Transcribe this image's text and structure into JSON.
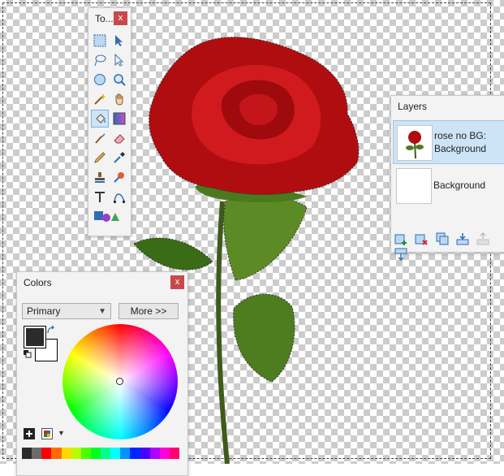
{
  "tools_panel": {
    "title": "To...",
    "close": "x",
    "tools": [
      {
        "icon": "rectangle-select-icon"
      },
      {
        "icon": "move-selection-icon"
      },
      {
        "icon": "lasso-select-icon"
      },
      {
        "icon": "move-selected-icon"
      },
      {
        "icon": "ellipse-select-icon"
      },
      {
        "icon": "zoom-icon"
      },
      {
        "icon": "magic-wand-icon"
      },
      {
        "icon": "pan-icon"
      },
      {
        "icon": "paint-bucket-icon"
      },
      {
        "icon": "gradient-icon"
      },
      {
        "icon": "paintbrush-icon"
      },
      {
        "icon": "eraser-icon"
      },
      {
        "icon": "pencil-icon"
      },
      {
        "icon": "color-picker-icon"
      },
      {
        "icon": "clone-stamp-icon"
      },
      {
        "icon": "recolor-icon"
      },
      {
        "icon": "text-icon"
      },
      {
        "icon": "line-curve-icon"
      },
      {
        "icon": "shapes-icon"
      }
    ],
    "active_tool": "paint-bucket-icon"
  },
  "layers_panel": {
    "title": "Layers",
    "layers": [
      {
        "name_line1": "rose no BG:",
        "name_line2": "Background"
      },
      {
        "name_line1": "Background",
        "name_line2": ""
      }
    ],
    "toolbar": [
      "add-layer-icon",
      "delete-layer-icon",
      "duplicate-layer-icon",
      "merge-layer-down-icon",
      "move-layer-up-icon",
      "move-layer-down-icon"
    ]
  },
  "colors_panel": {
    "title": "Colors",
    "close": "x",
    "mode": "Primary",
    "more_label": "More >>",
    "primary_color": "#2b2b2b",
    "secondary_color": "#ffffff",
    "palette": [
      "#2b2b2b",
      "#6b6b6b",
      "#ff0000",
      "#ff6a00",
      "#ffd800",
      "#b6ff00",
      "#4cff00",
      "#00ff21",
      "#00ff90",
      "#00ffff",
      "#0094ff",
      "#0026ff",
      "#4800ff",
      "#b200ff",
      "#ff00dc",
      "#ff006e"
    ]
  }
}
